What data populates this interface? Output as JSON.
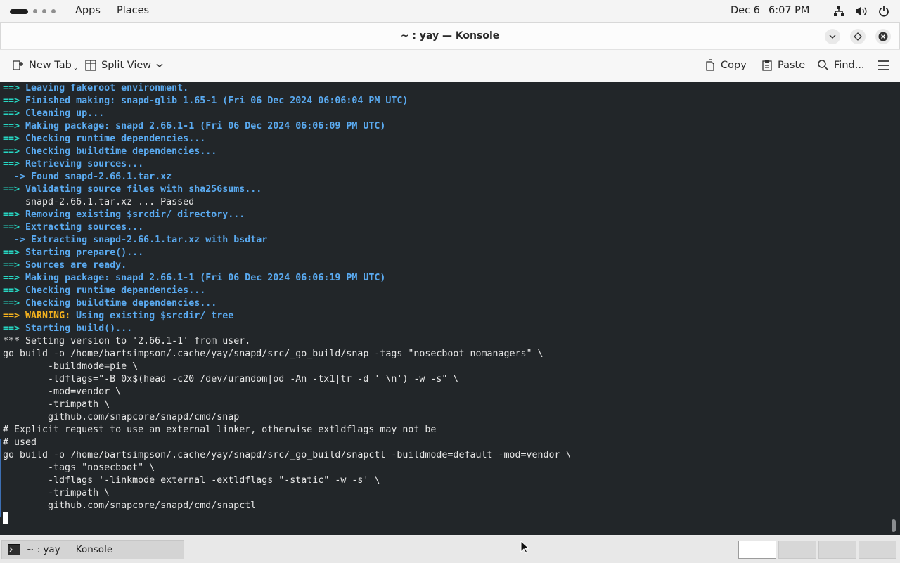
{
  "topbar": {
    "apps_label": "Apps",
    "places_label": "Places",
    "date": "Dec 6",
    "time": "6:07 PM",
    "tray_icons": [
      "network-icon",
      "volume-icon",
      "power-icon"
    ]
  },
  "window": {
    "title": "~ : yay — Konsole",
    "controls": [
      "minimize-icon",
      "maximize-icon",
      "close-icon"
    ]
  },
  "toolbar": {
    "new_tab": "New Tab",
    "split_view": "Split View",
    "copy": "Copy",
    "paste": "Paste",
    "find": "Find...",
    "menu_icon": "hamburger-menu-icon"
  },
  "terminal": {
    "lines": [
      {
        "type": "step",
        "text": "Leaving fakeroot environment."
      },
      {
        "type": "step",
        "text": "Finished making: snapd-glib 1.65-1 (Fri 06 Dec 2024 06:06:04 PM UTC)"
      },
      {
        "type": "step",
        "text": "Cleaning up..."
      },
      {
        "type": "step",
        "text": "Making package: snapd 2.66.1-1 (Fri 06 Dec 2024 06:06:09 PM UTC)"
      },
      {
        "type": "step",
        "text": "Checking runtime dependencies..."
      },
      {
        "type": "step",
        "text": "Checking buildtime dependencies..."
      },
      {
        "type": "step",
        "text": "Retrieving sources..."
      },
      {
        "type": "sub",
        "text": "Found snapd-2.66.1.tar.xz"
      },
      {
        "type": "step",
        "text": "Validating source files with sha256sums..."
      },
      {
        "type": "plain",
        "text": "    snapd-2.66.1.tar.xz ... Passed"
      },
      {
        "type": "step",
        "text": "Removing existing $srcdir/ directory..."
      },
      {
        "type": "step",
        "text": "Extracting sources..."
      },
      {
        "type": "sub",
        "text": "Extracting snapd-2.66.1.tar.xz with bsdtar"
      },
      {
        "type": "step",
        "text": "Starting prepare()..."
      },
      {
        "type": "step",
        "text": "Sources are ready."
      },
      {
        "type": "step",
        "text": "Making package: snapd 2.66.1-1 (Fri 06 Dec 2024 06:06:19 PM UTC)"
      },
      {
        "type": "step",
        "text": "Checking runtime dependencies..."
      },
      {
        "type": "step",
        "text": "Checking buildtime dependencies..."
      },
      {
        "type": "warning",
        "label": "WARNING:",
        "text": " Using existing $srcdir/ tree"
      },
      {
        "type": "step",
        "text": "Starting build()..."
      },
      {
        "type": "plain",
        "text": "*** Setting version to '2.66.1-1' from user."
      },
      {
        "type": "plain",
        "text": "go build -o /home/bartsimpson/.cache/yay/snapd/src/_go_build/snap -tags \"nosecboot nomanagers\" \\"
      },
      {
        "type": "plain",
        "text": "        -buildmode=pie \\"
      },
      {
        "type": "plain",
        "text": "        -ldflags=\"-B 0x$(head -c20 /dev/urandom|od -An -tx1|tr -d ' \\n') -w -s\" \\"
      },
      {
        "type": "plain",
        "text": "        -mod=vendor \\"
      },
      {
        "type": "plain",
        "text": "        -trimpath \\"
      },
      {
        "type": "plain",
        "text": "        github.com/snapcore/snapd/cmd/snap"
      },
      {
        "type": "plain",
        "text": "# Explicit request to use an external linker, otherwise extldflags may not be"
      },
      {
        "type": "plain",
        "text": "# used"
      },
      {
        "type": "plain",
        "text": "go build -o /home/bartsimpson/.cache/yay/snapd/src/_go_build/snapctl -buildmode=default -mod=vendor \\"
      },
      {
        "type": "plain",
        "text": "        -tags \"nosecboot\" \\"
      },
      {
        "type": "plain",
        "text": "        -ldflags '-linkmode external -extldflags \"-static\" -w -s' \\"
      },
      {
        "type": "plain",
        "text": "        -trimpath \\"
      },
      {
        "type": "plain",
        "text": "        github.com/snapcore/snapd/cmd/snapctl"
      },
      {
        "type": "cursor",
        "text": ""
      }
    ],
    "step_prefix": "==>",
    "sub_prefix": "  ->"
  },
  "taskbar": {
    "task_label": "~ : yay — Konsole",
    "workspaces": 4
  },
  "colors": {
    "terminal_bg": "#222629",
    "arrow": "#27d6c2",
    "message": "#5aaaf0",
    "warning": "#f2b01e"
  }
}
